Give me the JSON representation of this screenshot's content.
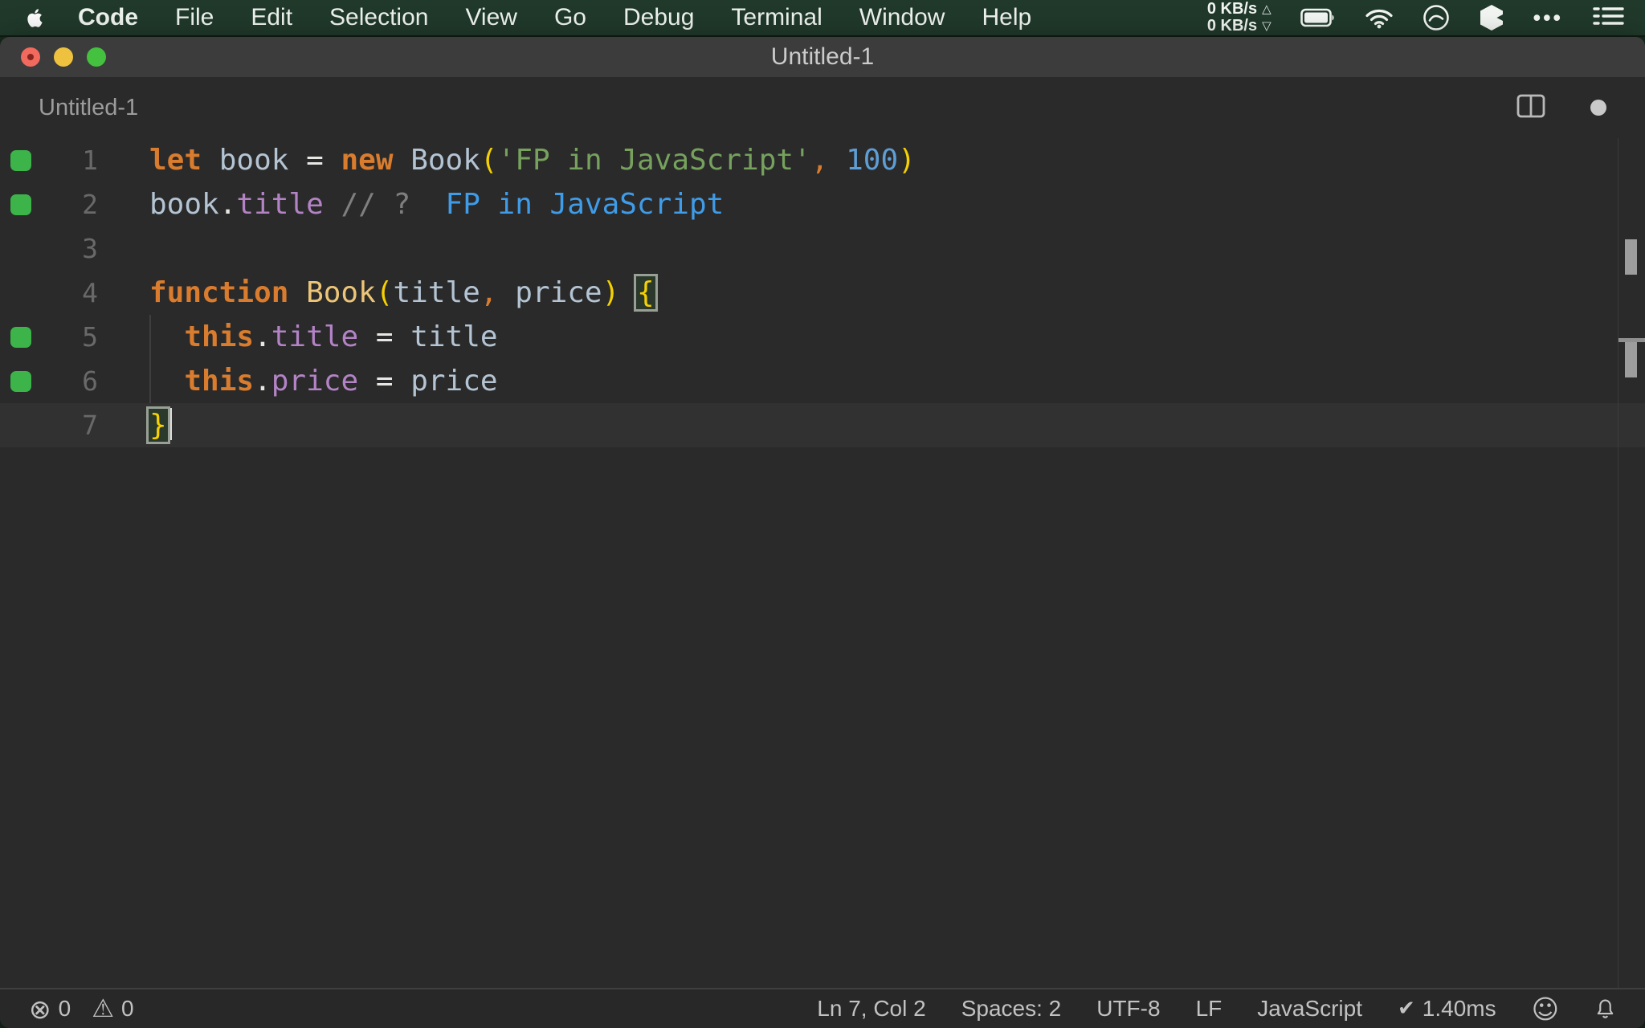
{
  "menu_bar": {
    "items": [
      "Code",
      "File",
      "Edit",
      "Selection",
      "View",
      "Go",
      "Debug",
      "Terminal",
      "Window",
      "Help"
    ],
    "network": {
      "up": "0 KB/s",
      "down": "0 KB/s"
    }
  },
  "window": {
    "title": "Untitled-1"
  },
  "editor_header": {
    "tab_label": "Untitled-1"
  },
  "editor": {
    "lines": [
      {
        "num": 1,
        "cov": true,
        "tokens": [
          {
            "t": "let",
            "c": "kw"
          },
          {
            "t": " ",
            "c": "pl"
          },
          {
            "t": "book",
            "c": "id"
          },
          {
            "t": " ",
            "c": "pl"
          },
          {
            "t": "=",
            "c": "op"
          },
          {
            "t": " ",
            "c": "pl"
          },
          {
            "t": "new",
            "c": "kw"
          },
          {
            "t": " ",
            "c": "pl"
          },
          {
            "t": "Book",
            "c": "id"
          },
          {
            "t": "(",
            "c": "brk"
          },
          {
            "t": "'FP in JavaScript'",
            "c": "str"
          },
          {
            "t": ",",
            "c": "comma"
          },
          {
            "t": " ",
            "c": "pl"
          },
          {
            "t": "100",
            "c": "num"
          },
          {
            "t": ")",
            "c": "brk"
          }
        ]
      },
      {
        "num": 2,
        "cov": true,
        "tokens": [
          {
            "t": "book",
            "c": "id"
          },
          {
            "t": ".",
            "c": "op"
          },
          {
            "t": "title",
            "c": "prop"
          },
          {
            "t": " ",
            "c": "pl"
          },
          {
            "t": "// ?",
            "c": "cmt"
          },
          {
            "t": "  ",
            "c": "pl"
          },
          {
            "t": "FP in JavaScript",
            "c": "out"
          }
        ]
      },
      {
        "num": 3,
        "cov": false,
        "tokens": []
      },
      {
        "num": 4,
        "cov": false,
        "tokens": [
          {
            "t": "function",
            "c": "kw"
          },
          {
            "t": " ",
            "c": "pl"
          },
          {
            "t": "Book",
            "c": "fn"
          },
          {
            "t": "(",
            "c": "brk"
          },
          {
            "t": "title",
            "c": "id"
          },
          {
            "t": ",",
            "c": "comma"
          },
          {
            "t": " ",
            "c": "pl"
          },
          {
            "t": "price",
            "c": "id"
          },
          {
            "t": ")",
            "c": "brk"
          },
          {
            "t": " ",
            "c": "pl"
          },
          {
            "t": "{",
            "c": "brk",
            "match": true
          }
        ]
      },
      {
        "num": 5,
        "cov": true,
        "indent": true,
        "tokens": [
          {
            "t": "  ",
            "c": "pl"
          },
          {
            "t": "this",
            "c": "kw"
          },
          {
            "t": ".",
            "c": "op"
          },
          {
            "t": "title",
            "c": "prop"
          },
          {
            "t": " ",
            "c": "pl"
          },
          {
            "t": "=",
            "c": "op"
          },
          {
            "t": " ",
            "c": "pl"
          },
          {
            "t": "title",
            "c": "id"
          }
        ]
      },
      {
        "num": 6,
        "cov": true,
        "indent": true,
        "tokens": [
          {
            "t": "  ",
            "c": "pl"
          },
          {
            "t": "this",
            "c": "kw"
          },
          {
            "t": ".",
            "c": "op"
          },
          {
            "t": "price",
            "c": "prop"
          },
          {
            "t": " ",
            "c": "pl"
          },
          {
            "t": "=",
            "c": "op"
          },
          {
            "t": " ",
            "c": "pl"
          },
          {
            "t": "price",
            "c": "id"
          }
        ]
      },
      {
        "num": 7,
        "cov": false,
        "current": true,
        "cursor": true,
        "tokens": [
          {
            "t": "}",
            "c": "brk",
            "match": true
          }
        ]
      }
    ]
  },
  "status_bar": {
    "errors": "0",
    "warnings": "0",
    "cursor_position": "Ln 7, Col 2",
    "indentation": "Spaces: 2",
    "encoding": "UTF-8",
    "eol": "LF",
    "language": "JavaScript",
    "quokka_time": "1.40ms"
  },
  "icons": {
    "errors_glyph": "⊗",
    "warnings_glyph": "⚠",
    "check_glyph": "✔",
    "smiley_glyph": "☺",
    "net_up_glyph": "△",
    "net_down_glyph": "▽",
    "ellipsis_glyph": "•••"
  },
  "colors": {
    "menu_bar_bg": "#20392b",
    "window_bg": "#2a2a2a",
    "title_bar_bg": "#3c3c3c",
    "status_bar_bg": "#282828",
    "keyword": "#d97c2e",
    "identifier": "#b4c4d3",
    "function_name": "#edc578",
    "property": "#b383c6",
    "string": "#76a25d",
    "number": "#5e9ed6",
    "bracket": "#f5d002",
    "operator": "#e6e6e3",
    "comment": "#7f7f7f",
    "inline_output": "#3f9ce8",
    "coverage_green": "#3cb44a"
  }
}
